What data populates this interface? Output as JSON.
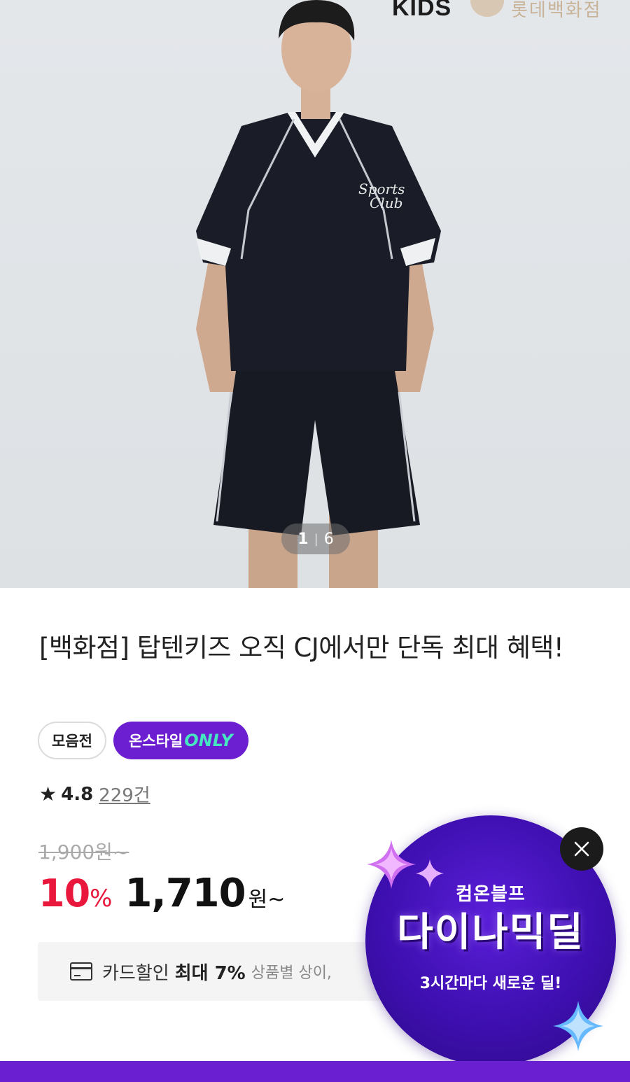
{
  "hero": {
    "brand_text": "KIDS",
    "brand_seal_text": "롯데백화점",
    "shirt_print_line1": "Sports",
    "shirt_print_line2": "Club",
    "counter_current": "1",
    "counter_separator": "|",
    "counter_total": "6"
  },
  "product": {
    "title": "[백화점] 탑텐키즈 오직 CJ에서만 단독 최대 혜택!",
    "tags": {
      "outline": "모음전",
      "purple_prefix": "온스타일",
      "purple_suffix": "ONLY"
    },
    "rating": {
      "star": "★",
      "score": "4.8",
      "count": "229건"
    },
    "original_price": "1,900원~",
    "discount": "10",
    "discount_unit": "%",
    "price": "1,710",
    "price_unit": "원~",
    "card": {
      "label": "카드할인",
      "bold": "최대 7%",
      "sub": "상품별 상이,"
    }
  },
  "promo": {
    "small": "컴온블프",
    "big": "다이나믹딜",
    "sub": "3시간마다 새로운 딜!",
    "close_icon": "close-icon"
  },
  "colors": {
    "accent_purple": "#6b1fd1",
    "discount_red": "#e8173b",
    "only_green": "#45e6c0"
  }
}
